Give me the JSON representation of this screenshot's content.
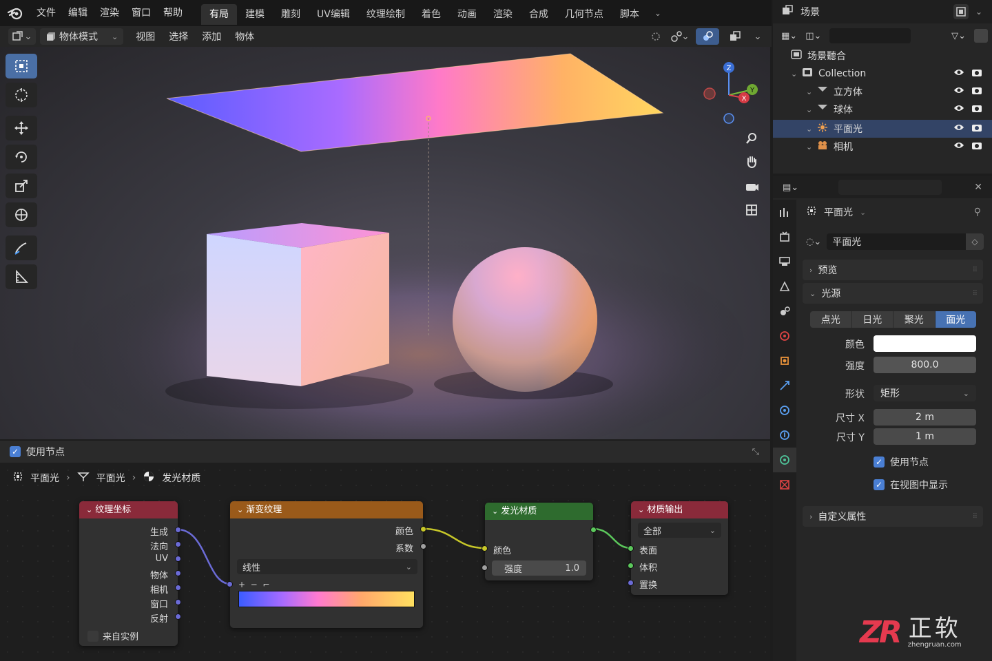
{
  "menubar": {
    "items": [
      "文件",
      "编辑",
      "渲染",
      "窗口",
      "帮助"
    ]
  },
  "workspaces": {
    "tabs": [
      "有局",
      "建模",
      "雕刻",
      "UV编辑",
      "纹理绘制",
      "着色",
      "动画",
      "渲染",
      "合成",
      "几何节点",
      "脚本"
    ],
    "active": "有局"
  },
  "viewport_header": {
    "mode": "物体模式",
    "menus": [
      "视图",
      "选择",
      "添加",
      "物体"
    ]
  },
  "node_editor": {
    "use_nodes_label": "使用节点",
    "breadcrumb": [
      "平面光",
      "平面光",
      "发光材质"
    ],
    "nodes": {
      "texcoord": {
        "title": "纹理坐标",
        "outputs": [
          "生成",
          "法向",
          "UV",
          "物体",
          "相机",
          "窗口",
          "反射"
        ],
        "from_instancer": "来自实例"
      },
      "gradient": {
        "title": "渐变纹理",
        "outputs": [
          "颜色",
          "系数"
        ],
        "type": "线性"
      },
      "emission": {
        "title": "发光材质",
        "color_label": "颜色",
        "strength_label": "强度",
        "strength_value": "1.0"
      },
      "output": {
        "title": "材质输出",
        "target": "全部",
        "inputs": [
          "表面",
          "体积",
          "置换"
        ]
      }
    },
    "colors": {
      "texcoord": "#8a2a3a",
      "gradient": "#9a5a1a",
      "emission": "#2e6b2e",
      "output": "#8a2a3a",
      "socket_purple": "#6b6bd6",
      "socket_yellow": "#c7c729",
      "socket_green": "#5cc85c",
      "socket_gray": "#a0a0a0"
    }
  },
  "outliner": {
    "title": "场景",
    "scene_collection": "场景聽合",
    "items": [
      {
        "name": "Collection"
      },
      {
        "name": "立方体"
      },
      {
        "name": "球体"
      },
      {
        "name": "平面光",
        "selected": true
      },
      {
        "name": "相机"
      }
    ]
  },
  "properties": {
    "object_name": "平面光",
    "data_name": "平面光",
    "sections": {
      "preview": "预览",
      "light": "光源",
      "custom": "自定义属性"
    },
    "light_types": [
      "点光",
      "日光",
      "聚光",
      "面光"
    ],
    "active_type": "面光",
    "fields": {
      "color_label": "颜色",
      "color_value": "#ffffff",
      "power_label": "强度",
      "power_value": "800.0",
      "shape_label": "形状",
      "shape_value": "矩形",
      "size_x_label": "尺寸 X",
      "size_x_value": "2 m",
      "size_y_label": "尺寸 Y",
      "size_y_value": "1 m",
      "use_nodes_label": "使用节点",
      "show_viewport_label": "在视图中显示"
    }
  },
  "gizmo": {
    "x": "X",
    "y": "Y",
    "z": "Z"
  },
  "watermark": {
    "logo": "ZR",
    "text": "正软",
    "url": "zhengruan.com"
  }
}
